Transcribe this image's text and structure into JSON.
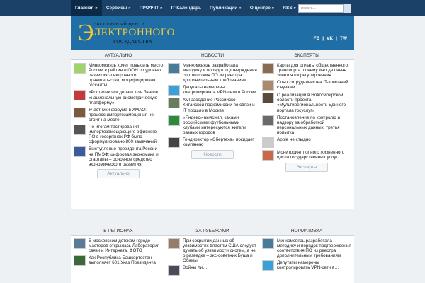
{
  "nav": {
    "items": [
      "Главная »",
      "Сервисы »",
      "ПРОФ-IT »",
      "IT-Календарь",
      "Публикации »",
      "О центре »",
      "RSS »"
    ],
    "search_placeholder": "искать..."
  },
  "logo": {
    "line1": "ЭКСПЕРТНЫЙ ЦЕНТР",
    "letter": "Э",
    "line2": "ЛЕКТРОННОГО",
    "line3": "ГОСУДАРСТВА"
  },
  "social": [
    "FB",
    "|",
    "VK",
    "|",
    "TW"
  ],
  "columns": [
    {
      "title": "АКТУАЛЬНО",
      "items": [
        "Минкомсвязь хочет повысить место России в рейтинге ООН по уровню развития электронного правительства, модифицировав госсайты",
        "«Ростелеком» делает для банков «национальную биометрическую платформу»",
        "Участники форума в ХМАО: процесс импортозамещения не стоит на месте",
        "По итогам тестирования импортозамещающего офисного ПО в госорганах РФ было сформулировано 800 замечаний",
        "Выступление президента России на ПМЭФ: цифровая экономика и стартапы – основное средство экономического развития"
      ],
      "more": "Актуально"
    },
    {
      "title": "НОВОСТИ",
      "items": [
        "Минкомсвязь разработала методику и порядок подтверждения соответствия ПО из реестра дополнительным требованиям",
        "Депутаты намерены контролировать VPN-сети в России",
        "XVI заседание Российско-Китайской подкомиссии по связи и IT прошло в Москве",
        "«Яндекс» выяснил, каками российскими футбольными клубами интересуются жители разных городов",
        "Гендиректор «Сбертеха» покидает компанию"
      ],
      "more": "Новости"
    },
    {
      "title": "ЭКСПЕРТЫ",
      "items": [
        "Карты для оплаты общественного транспорта: почему иногда очень хочется госрегулирования",
        "Опыт сотрудничества IT-компаний с вузами",
        "О реализации в Новосибирской области проекта «Мультирегиональность Единого портала госуслуг»",
        "Постановление по контролю и надзору за обработкой персональных данных: третья попытка",
        "Apple не стыдно",
        "Мониторинг полного жизненного цикла государственных услуг"
      ],
      "more": "Эксперты"
    },
    {
      "title": "В РЕГИОНАХ",
      "items": [
        "В московском детском городе мастеров открылась Лаборатория связи и Интернета. ФОТО",
        "Как Республика Башкортостан выполняет 601 Указ Президента"
      ]
    },
    {
      "title": "ЗА РУБЕЖАМИ",
      "items": [
        "При сокрытии данных об уязвимостях властям США следует думать об уязвимости систем, а не о разведке – экс-советник Буша и Обамы",
        "Войны ли…"
      ]
    },
    {
      "title": "НОРМАТИВКА",
      "items": [
        "Минкомсвязь разработала методику и порядок подтверждения соответствия ПО из реестра дополнительным требованиям",
        "Депутаты намерены контролировать VPN-сети в…"
      ]
    }
  ]
}
